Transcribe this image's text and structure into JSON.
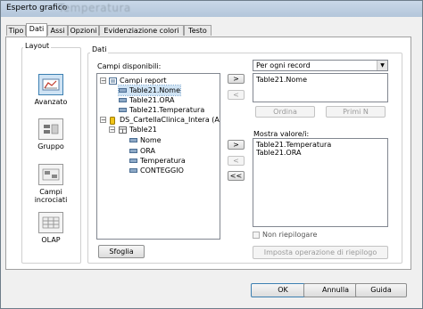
{
  "window": {
    "title": "Esperto grafico",
    "ghost_title": "Temperatura"
  },
  "tabs": [
    "Tipo",
    "Dati",
    "Assi",
    "Opzioni",
    "Evidenziazione colori",
    "Testo"
  ],
  "layout": {
    "label": "Layout",
    "items": [
      {
        "label": "Avanzato",
        "selected": true
      },
      {
        "label": "Gruppo",
        "selected": false
      },
      {
        "label": "Campi incrociati",
        "selected": false
      },
      {
        "label": "OLAP",
        "selected": false
      }
    ]
  },
  "dati": {
    "label": "Dati",
    "available_label": "Campi disponibili:",
    "tree": {
      "report_fields": "Campi report",
      "report_items": [
        "Table21.Nome",
        "Table21.ORA",
        "Table21.Temperatura"
      ],
      "datasource": "DS_CartellaClinica_Intera (ADO.N",
      "table": "Table21",
      "table_fields": [
        "Nome",
        "ORA",
        "Temperatura",
        "CONTEGGIO"
      ]
    },
    "buttons": {
      "add_top": ">",
      "remove_top": "<",
      "add_bottom": ">",
      "remove_bottom": "<",
      "remove_all": "<<"
    },
    "group_select": "Per ogni record",
    "group_list": [
      "Table21.Nome"
    ],
    "order_button": "Ordina",
    "topn_button": "Primi N",
    "show_value_label": "Mostra valore/i:",
    "value_list": [
      "Table21.Temperatura",
      "Table21.ORA"
    ],
    "no_summary_label": "Non riepilogare",
    "summary_button": "Imposta operazione di riepilogo",
    "browse_button": "Sfoglia"
  },
  "footer": {
    "ok": "OK",
    "cancel": "Annulla",
    "help": "Guida"
  }
}
